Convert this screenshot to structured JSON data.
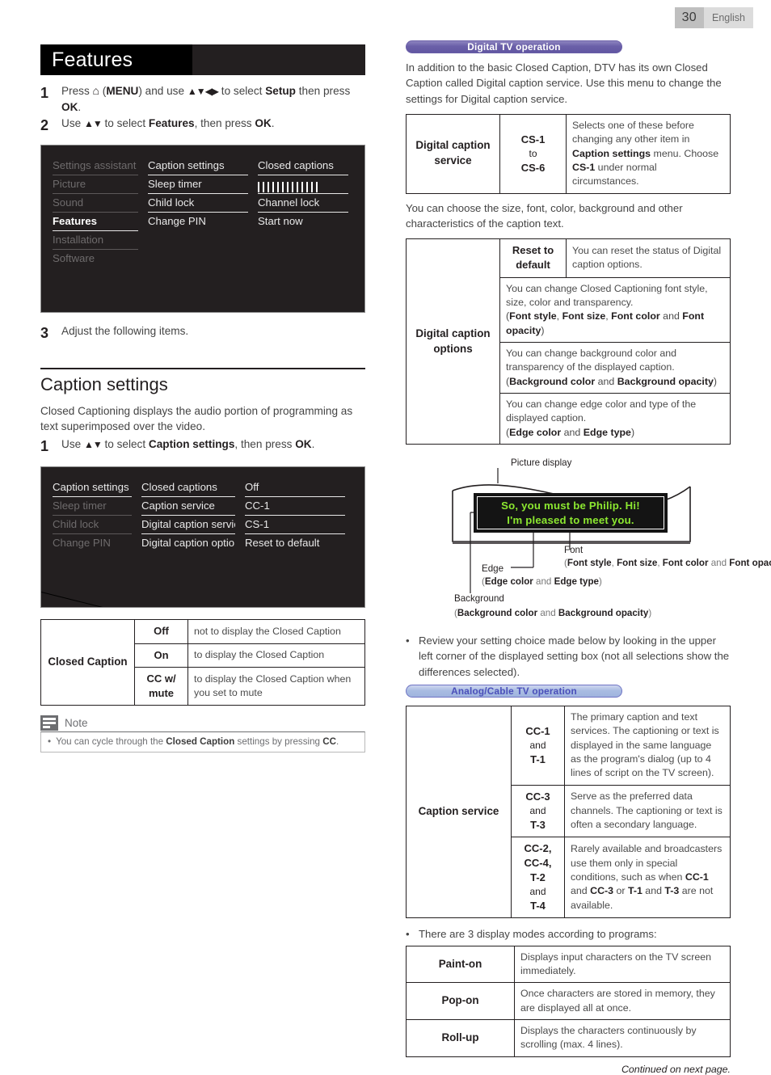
{
  "header": {
    "page_number": "30",
    "language": "English"
  },
  "left": {
    "section_title": "Features",
    "steps": [
      {
        "num": "1",
        "parts": [
          "Press ",
          "home-icon",
          " (",
          "MENU",
          ") and use ",
          "arrows-4",
          " to select ",
          "Setup",
          " then press ",
          "OK",
          "."
        ]
      },
      {
        "num": "2",
        "parts": [
          "Use ",
          "arrows-2",
          " to select ",
          "Features",
          ", then press ",
          "OK",
          "."
        ]
      }
    ],
    "step1": {
      "t1": "Press ",
      "t2": " (",
      "menu": "MENU",
      "t3": ") and use ",
      "t4": " to select ",
      "setup": "Setup",
      "t5": " then press ",
      "ok": "OK",
      "t6": "."
    },
    "step2": {
      "t1": "Use ",
      "t2": " to select ",
      "features": "Features",
      "t3": ", then press ",
      "ok": "OK",
      "t4": "."
    },
    "step3": {
      "num": "3",
      "text": "Adjust the following items."
    },
    "menu1": {
      "col1": [
        "Settings assistant",
        "Picture",
        "Sound",
        "Features",
        "Installation",
        "Software"
      ],
      "col1_selected_index": 3,
      "col2": [
        "Caption settings",
        "Sleep timer",
        "Child lock",
        "Change PIN"
      ],
      "col3": [
        "Closed captions",
        "",
        "Channel lock",
        "Start now"
      ],
      "col3_bar_row_index": 1,
      "bar_count": 13
    },
    "caption_heading": "Caption settings",
    "caption_intro": "Closed Captioning displays the audio portion of programming as text superimposed over the video.",
    "caption_step1": {
      "num": "1",
      "t1": "Use ",
      "t2": " to select ",
      "bold1": "Caption settings",
      "t3": ", then press ",
      "bold2": "OK",
      "t4": "."
    },
    "menu2": {
      "col1": [
        "Caption settings",
        "Sleep timer",
        "Child lock",
        "Change PIN"
      ],
      "col1_selected_index": 0,
      "col2": [
        "Closed captions",
        "Caption service",
        "Digital caption service",
        "Digital caption options"
      ],
      "col3": [
        "Off",
        "CC-1",
        "CS-1",
        "Reset to default"
      ]
    },
    "cc_table": {
      "row_label": "Closed Caption",
      "rows": [
        {
          "key": "Off",
          "desc": "not to display the Closed Caption"
        },
        {
          "key": "On",
          "desc": "to display the Closed Caption"
        },
        {
          "key": "CC w/ mute",
          "desc": "to display the Closed Caption when you set to mute"
        }
      ]
    },
    "note": {
      "title": "Note",
      "bullet": "•",
      "t1": "You can cycle through the ",
      "b1": "Closed Caption",
      "t2": " settings by pressing ",
      "b2": "CC",
      "t3": "."
    }
  },
  "right": {
    "badge_digital": "Digital TV operation",
    "intro_digital": "In addition to the basic Closed Caption, DTV has its own Closed Caption called Digital caption service. Use this menu to change the settings for Digital caption service.",
    "dcs_table": {
      "label": "Digital caption service",
      "key_line1": "CS-1",
      "key_line2": "to",
      "key_line3": "CS-6",
      "desc_t1": "Selects one of these before changing any other item in ",
      "desc_b1": "Caption settings",
      "desc_t2": " menu. Choose ",
      "desc_b2": "CS-1",
      "desc_t3": " under normal circumstances."
    },
    "intro_options": "You can choose the size, font, color, background and other characteristics of the caption text.",
    "dco_table": {
      "label": "Digital caption options",
      "reset_key_line1": "Reset to",
      "reset_key_line2": "default",
      "reset_desc": "You can reset the status of Digital caption options.",
      "rows": [
        {
          "t1": "You can change Closed Captioning font style, size, color and transparency.",
          "p_open": "(",
          "b1": "Font style",
          "s1": ", ",
          "b2": "Font size",
          "s2": ", ",
          "b3": "Font color",
          "s3": " and ",
          "b4": "Font opacity",
          "p_close": ")"
        },
        {
          "t1": "You can change background color and transparency of the displayed caption.",
          "p_open": "(",
          "b1": "Background color",
          "s1": " and ",
          "b2": "Background opacity",
          "p_close": ")"
        },
        {
          "t1": "You can change edge color and type of the displayed caption.",
          "p_open": "(",
          "b1": "Edge color",
          "s1": " and ",
          "b2": "Edge type",
          "p_close": ")"
        }
      ]
    },
    "diagram": {
      "picture_display": "Picture display",
      "cc_line1": "So, you must be Philip. Hi!",
      "cc_line2": "I'm pleased to meet you.",
      "font_label": "Font",
      "font_paren_open": "(",
      "font_b1": "Font style",
      "font_s1": ", ",
      "font_b2": "Font size",
      "font_s2": ", ",
      "font_b3": "Font color",
      "font_s3": " and ",
      "font_b4": "Font opacity",
      "font_paren_close": ")",
      "edge_label": "Edge",
      "edge_paren_open": "(",
      "edge_b1": "Edge color",
      "edge_s1": " and ",
      "edge_b2": "Edge type",
      "edge_paren_close": ")",
      "background_label": "Background",
      "bg_paren_open": "(",
      "bg_b1": "Background color",
      "bg_s1": " and ",
      "bg_b2": "Background opacity",
      "bg_paren_close": ")",
      "caption_text_color": "#8ce830",
      "caption_bg_color": "#141414"
    },
    "review_bullet": {
      "b": "•",
      "text": "Review your setting choice made below by looking in the upper left corner of the displayed setting box (not all selections show the differences selected)."
    },
    "badge_analog": "Analog/Cable TV operation",
    "cs_table": {
      "label": "Caption service",
      "rows": [
        {
          "k1": "CC-1",
          "k2": "and",
          "k3": "T-1",
          "desc": "The primary caption and text services. The captioning or text is displayed in the same language as the program's dialog (up to 4 lines of script on the TV screen)."
        },
        {
          "k1": "CC-3",
          "k2": "and",
          "k3": "T-3",
          "desc": "Serve as the preferred data channels. The captioning or text is often a secondary language."
        },
        {
          "k1": "CC-2,",
          "k2": "CC-4,",
          "k3": "T-2",
          "k4": "and",
          "k5": "T-4",
          "desc_t1": "Rarely available and broadcasters use them only in special conditions, such as when ",
          "desc_b1": "CC-1",
          "desc_t2": " and ",
          "desc_b2": "CC-3",
          "desc_t3": " or ",
          "desc_b3": "T-1",
          "desc_t4": " and ",
          "desc_b4": "T-3",
          "desc_t5": " are not available."
        }
      ]
    },
    "modes_bullet": {
      "b": "•",
      "text": "There are 3 display modes according to programs:"
    },
    "modes_table": {
      "rows": [
        {
          "label": "Paint-on",
          "desc": "Displays input characters on the TV screen immediately."
        },
        {
          "label": "Pop-on",
          "desc": "Once characters are stored in memory, they are displayed all at once."
        },
        {
          "label": "Roll-up",
          "desc": "Displays the characters continuously by scrolling (max. 4 lines)."
        }
      ]
    },
    "continued": "Continued on next page."
  },
  "colors": {
    "badge_purple": "#6a5fa8",
    "badge_blue_text": "#4a4fba",
    "caption_green": "#8ce830",
    "menu_bg": "#231f20"
  }
}
